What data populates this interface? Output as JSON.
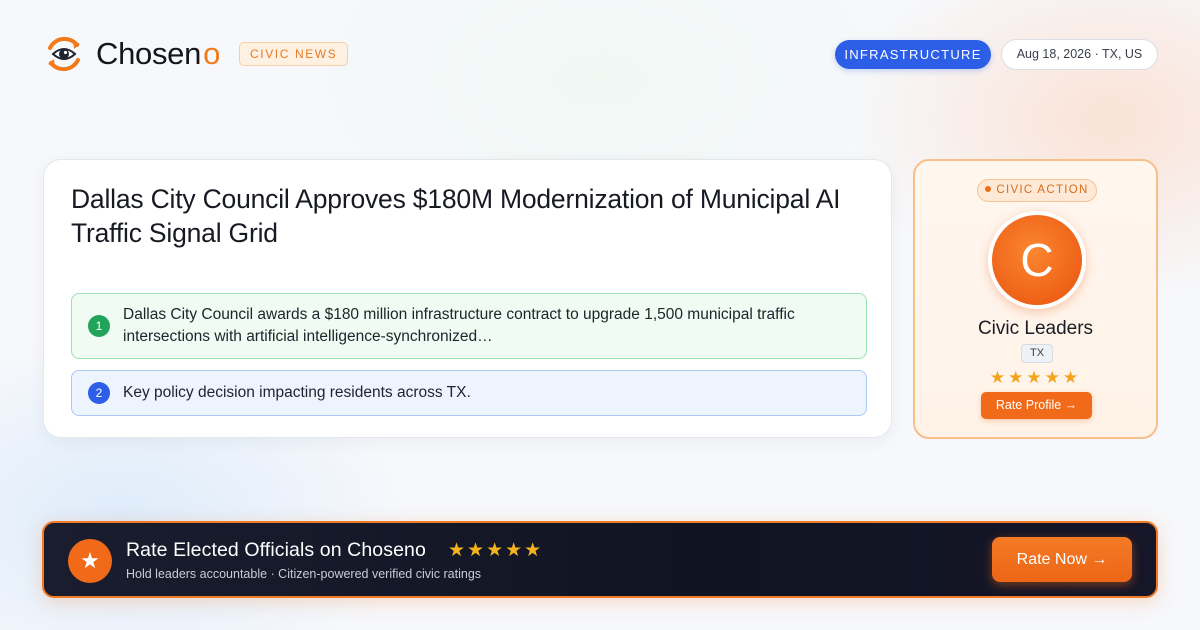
{
  "brand": {
    "name_main": "Chosen",
    "name_accent": "o",
    "section_badge": "CIVIC NEWS",
    "accent_color": "#f07a1c",
    "icon": "eye-logo-icon"
  },
  "header": {
    "category": "INFRASTRUCTURE",
    "date_location": "Aug 18, 2026 · TX, US"
  },
  "article": {
    "headline": "Dallas City Council Approves $180M Modernization of Municipal AI Traffic Signal Grid",
    "points": [
      {
        "num": "1",
        "text": "Dallas City Council awards a $180 million infrastructure contract to upgrade 1,500 municipal traffic intersections with artificial intelligence-synchronized…"
      },
      {
        "num": "2",
        "text": "Key policy decision impacting residents across TX."
      }
    ]
  },
  "civic_action": {
    "badge": "CIVIC ACTION",
    "avatar_letter": "C",
    "name": "Civic Leaders",
    "state": "TX",
    "stars": "★★★★★",
    "button_label": "Rate Profile →"
  },
  "banner": {
    "icon": "star-icon",
    "title": "Rate Elected Officials on Choseno",
    "stars": "★★★★★",
    "subtitle": "Hold leaders accountable · Citizen-powered verified civic ratings",
    "button_label": "Rate Now →"
  }
}
